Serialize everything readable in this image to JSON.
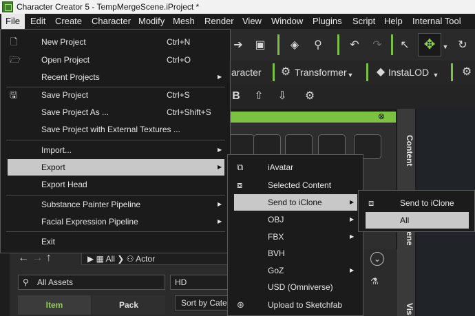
{
  "window": {
    "title": "Character Creator 5 - TempMergeScene.iProject *"
  },
  "menubar": {
    "items": [
      {
        "label": "File"
      },
      {
        "label": "Edit"
      },
      {
        "label": "Create"
      },
      {
        "label": "Character"
      },
      {
        "label": "Modify"
      },
      {
        "label": "Mesh"
      },
      {
        "label": "Render"
      },
      {
        "label": "View"
      },
      {
        "label": "Window"
      },
      {
        "label": "Plugins"
      },
      {
        "label": "Script"
      },
      {
        "label": "Help"
      },
      {
        "label": "Internal Tool"
      }
    ],
    "active": "File"
  },
  "file_menu": {
    "new_project": {
      "label": "New Project",
      "shortcut": "Ctrl+N"
    },
    "open_project": {
      "label": "Open Project",
      "shortcut": "Ctrl+O"
    },
    "recent_projects": {
      "label": "Recent Projects"
    },
    "save_project": {
      "label": "Save Project",
      "shortcut": "Ctrl+S"
    },
    "save_project_as": {
      "label": "Save Project As ...",
      "shortcut": "Ctrl+Shift+S"
    },
    "save_with_textures": {
      "label": "Save Project with External Textures ..."
    },
    "import": {
      "label": "Import..."
    },
    "export": {
      "label": "Export"
    },
    "export_head": {
      "label": "Export Head"
    },
    "substance_painter": {
      "label": "Substance Painter Pipeline"
    },
    "facial_expression": {
      "label": "Facial Expression Pipeline"
    },
    "exit": {
      "label": "Exit"
    }
  },
  "export_menu": {
    "iavatar": {
      "label": "iAvatar"
    },
    "selected_content": {
      "label": "Selected Content"
    },
    "send_to_iclone": {
      "label": "Send to iClone"
    },
    "obj": {
      "label": "OBJ"
    },
    "fbx": {
      "label": "FBX"
    },
    "bvh": {
      "label": "BVH"
    },
    "goz": {
      "label": "GoZ"
    },
    "usd": {
      "label": "USD (Omniverse)"
    },
    "sketchfab": {
      "label": "Upload to Sketchfab"
    }
  },
  "send_menu": {
    "send_to_iclone": {
      "label": "Send to iClone"
    },
    "all": {
      "label": "All"
    }
  },
  "toolbar": {
    "character_tab": "aracter",
    "transformer": "Transformer",
    "instalod": "InstaLOD"
  },
  "side_tabs": {
    "content": "Content",
    "scene": "ene",
    "visual": "Vis"
  },
  "content_browser": {
    "path_all": "All",
    "path_actor": "Actor",
    "assets_filter": "All Assets",
    "quality": "HD",
    "tab_item": "Item",
    "tab_pack": "Pack",
    "sort": "Sort by Cate"
  },
  "colors": {
    "accent_green": "#7bc142",
    "highlight": "#c8c8c8"
  }
}
